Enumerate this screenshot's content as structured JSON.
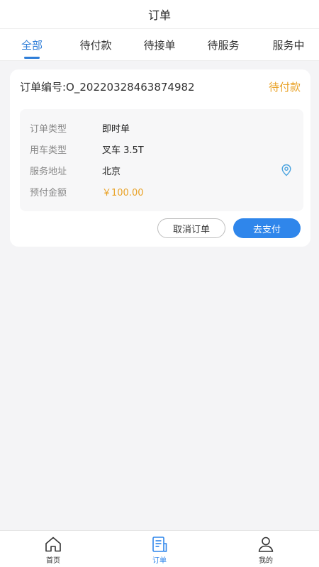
{
  "header": {
    "title": "订单"
  },
  "tabs": [
    {
      "label": "全部",
      "active": true
    },
    {
      "label": "待付款",
      "active": false
    },
    {
      "label": "待接单",
      "active": false
    },
    {
      "label": "待服务",
      "active": false
    },
    {
      "label": "服务中",
      "active": false
    }
  ],
  "order": {
    "number": "订单编号:O_20220328463874982",
    "status": "待付款",
    "rows": [
      {
        "label": "订单类型",
        "value": "即时单"
      },
      {
        "label": "用车类型",
        "value": "叉车 3.5T"
      },
      {
        "label": "服务地址",
        "value": "北京"
      },
      {
        "label": "预付金额",
        "value": "￥100.00"
      }
    ],
    "cancel_label": "取消订单",
    "pay_label": "去支付"
  },
  "bottom_nav": [
    {
      "label": "首页",
      "icon": "home-icon",
      "active": false
    },
    {
      "label": "订单",
      "icon": "order-list-icon",
      "active": true
    },
    {
      "label": "我的",
      "icon": "user-icon",
      "active": false
    }
  ],
  "colors": {
    "accent": "#2f86eb",
    "warning": "#e9a227"
  }
}
